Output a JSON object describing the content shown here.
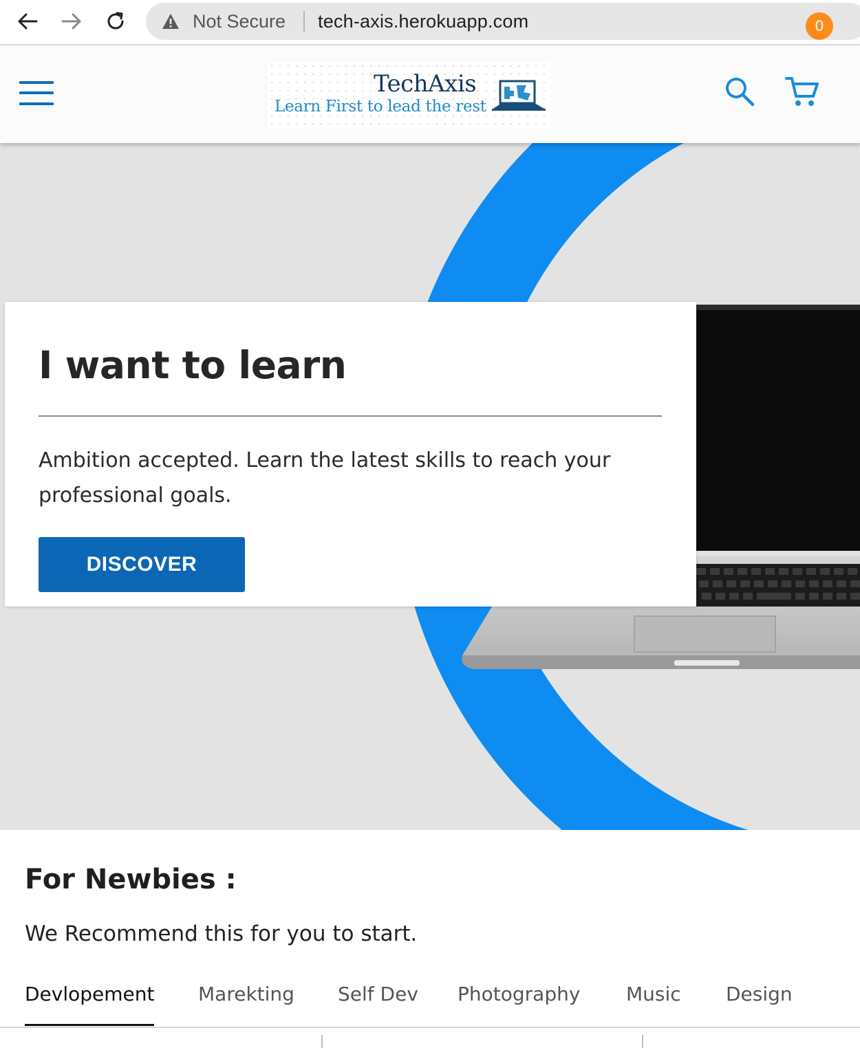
{
  "browser": {
    "security_label": "Not Secure",
    "url": "tech-axis.herokuapp.com",
    "icons": [
      "back-arrow-icon",
      "forward-arrow-icon",
      "reload-icon",
      "warning-icon"
    ]
  },
  "header": {
    "logo_title": "TechAxis",
    "logo_tagline": "Learn First to lead the rest",
    "cart_count": "0",
    "accent_color": "#0a6ebd",
    "badge_color": "#ff8c1a",
    "icons": [
      "hamburger-menu-icon",
      "search-icon",
      "cart-icon"
    ]
  },
  "hero": {
    "heading": "I want to learn",
    "text": "Ambition accepted. Learn the latest skills to reach your professional goals.",
    "button_label": "DISCOVER",
    "button_color": "#0b67b5"
  },
  "newbies": {
    "title": "For Newbies :",
    "subtitle": "We Recommend this for you to start.",
    "tabs": [
      {
        "label": "Devlopement",
        "active": true
      },
      {
        "label": "Marekting",
        "active": false
      },
      {
        "label": "Self Dev",
        "active": false
      },
      {
        "label": "Photography",
        "active": false
      },
      {
        "label": "Music",
        "active": false
      },
      {
        "label": "Design",
        "active": false
      }
    ]
  }
}
